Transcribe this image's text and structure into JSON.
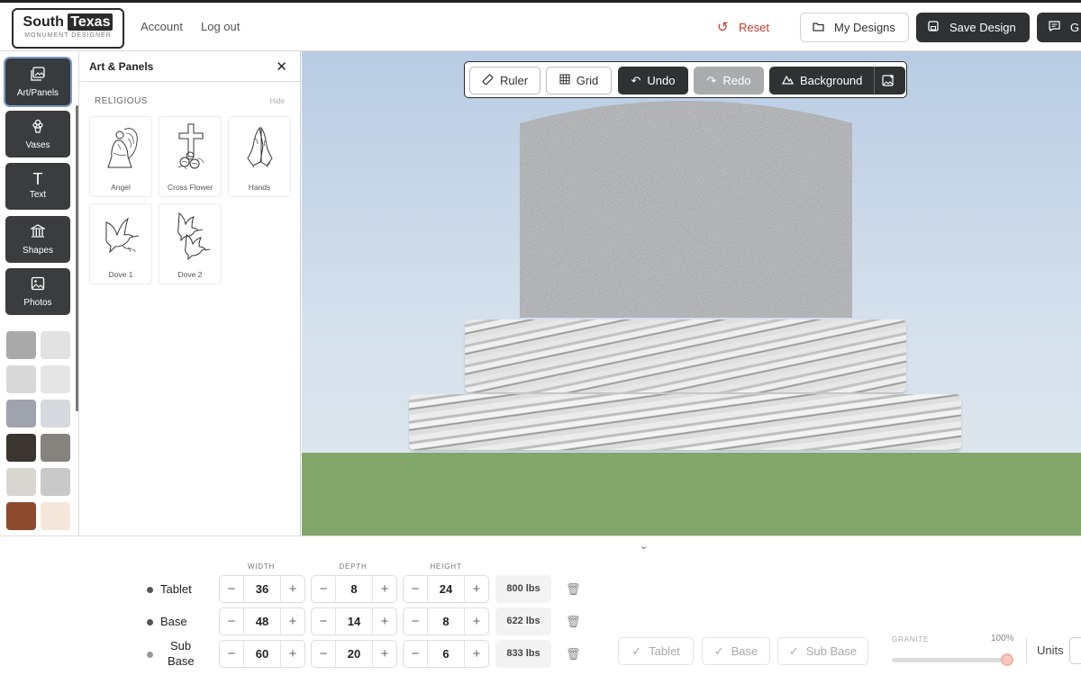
{
  "header": {
    "logo_main_1": "South",
    "logo_main_2": "Texas",
    "logo_sub": "MONUMENT DESIGNER",
    "account": "Account",
    "logout": "Log out",
    "reset": "Reset",
    "my_designs": "My Designs",
    "save_design": "Save Design",
    "cut_button": "G"
  },
  "sidebar": {
    "tools": [
      {
        "label": "Art/Panels",
        "icon": "image-icon"
      },
      {
        "label": "Vases",
        "icon": "flower-icon"
      },
      {
        "label": "Text",
        "icon": "text-icon"
      },
      {
        "label": "Shapes",
        "icon": "columns-icon"
      },
      {
        "label": "Photos",
        "icon": "photo-icon"
      }
    ],
    "swatch_colors": [
      "#a9a9a9",
      "#e2e2e2",
      "#d9d9d9",
      "#e6e6e6",
      "#9fa3ae",
      "#d6d9dd",
      "#3b3530",
      "#86827d",
      "#d9d5d0",
      "#c9c9c9",
      "#8d4a2c",
      "#f5e6da"
    ]
  },
  "panel": {
    "title": "Art & Panels",
    "section": "RELIGIOUS",
    "hide": "Hide",
    "items": [
      "Angel",
      "Cross Flower",
      "Hands",
      "Dove 1",
      "Dove 2"
    ]
  },
  "canvas_toolbar": {
    "ruler": "Ruler",
    "grid": "Grid",
    "undo": "Undo",
    "redo": "Redo",
    "background": "Background"
  },
  "dimensions": {
    "col_width": "WIDTH",
    "col_depth": "DEPTH",
    "col_height": "HEIGHT",
    "rows": [
      {
        "name": "Tablet",
        "width": "36",
        "depth": "8",
        "height": "24",
        "weight": "800 lbs"
      },
      {
        "name": "Base",
        "width": "48",
        "depth": "14",
        "height": "8",
        "weight": "622 lbs"
      },
      {
        "name": "Sub Base",
        "name_1": "Sub",
        "name_2": "Base",
        "width": "60",
        "depth": "20",
        "height": "6",
        "weight": "833 lbs"
      }
    ]
  },
  "toggles": [
    "Tablet",
    "Base",
    "Sub Base"
  ],
  "granite": {
    "label": "GRANITE",
    "percent": "100%",
    "level": 1.0
  },
  "units_label": "Units",
  "colors": {
    "dark": "#2f3133",
    "reset": "#c0392b",
    "grass": "#83a66b",
    "sky": "#b9cce3"
  }
}
